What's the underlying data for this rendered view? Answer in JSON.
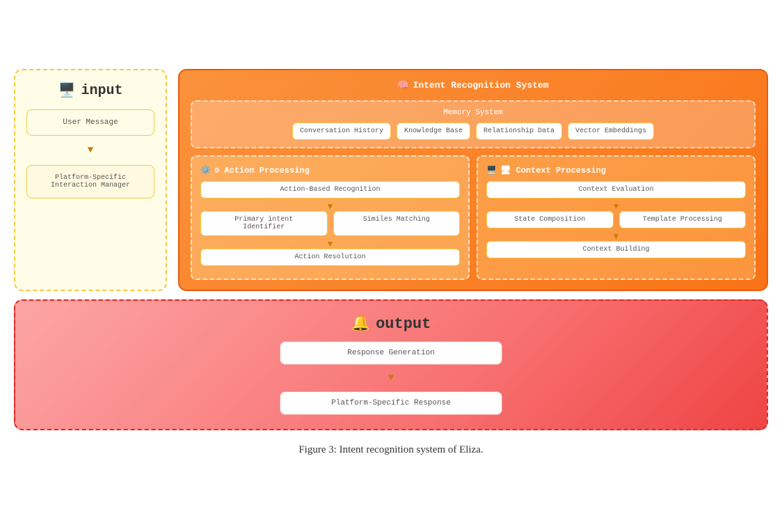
{
  "input": {
    "title": "input",
    "icon": "🖥️",
    "user_message": "User Message",
    "platform_manager": "Platform-Specific\nInteraction Manager"
  },
  "intent_system": {
    "title": "Intent Recognition System",
    "icon": "🧠",
    "memory": {
      "title": "Memory System",
      "items": [
        "Conversation History",
        "Knowledge Base",
        "Relationship Data",
        "Vector Embeddings"
      ]
    },
    "action_processing": {
      "title": "⚙ Action Processing",
      "action_recognition": "Action-Based Recognition",
      "primary_intent": "Primary intent\nIdentifier",
      "similes_matching": "Similes Matching",
      "action_resolution": "Action Resolution"
    },
    "context_processing": {
      "title": "🖥 Context Processing",
      "context_evaluation": "Context Evaluation",
      "state_composition": "State Composition",
      "template_processing": "Template Processing",
      "context_building": "Context Building"
    }
  },
  "output": {
    "title": "output",
    "icon": "🔔",
    "response_generation": "Response Generation",
    "platform_response": "Platform-Specific Response"
  },
  "caption": "Figure 3:  Intent recognition system of Eliza."
}
